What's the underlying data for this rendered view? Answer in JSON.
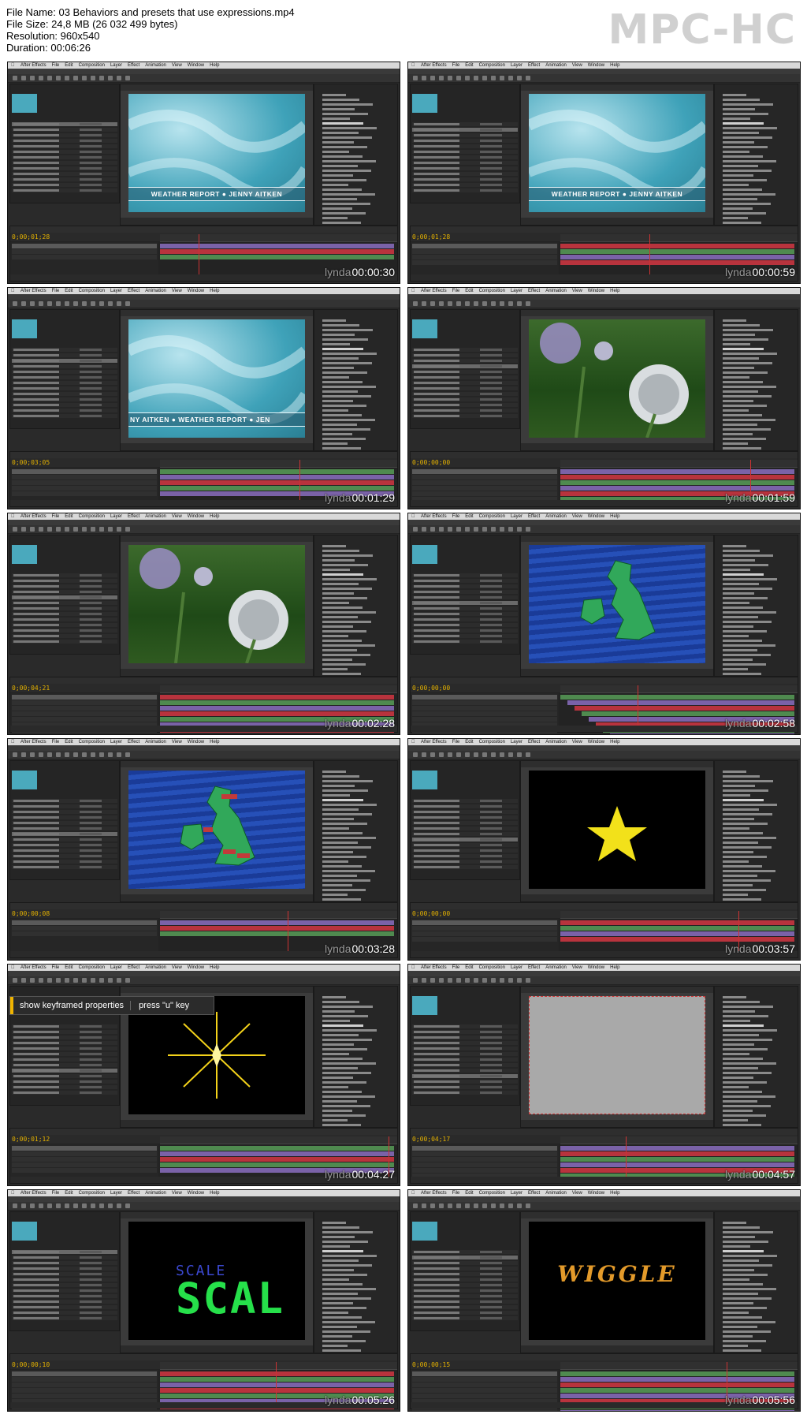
{
  "file_info": {
    "name": "File Name: 03 Behaviors and presets that use expressions.mp4",
    "size": "File Size: 24,8 MB (26 032 499 bytes)",
    "resolution": "Resolution: 960x540",
    "duration": "Duration: 00:06:26"
  },
  "brand": "MPC-HC",
  "watermark": "lynda",
  "app_menu": [
    "After Effects",
    "File",
    "Edit",
    "Composition",
    "Layer",
    "Effect",
    "Animation",
    "View",
    "Window",
    "Help"
  ],
  "lower_third": {
    "a": "WEATHER REPORT",
    "sep": "●",
    "b": "JENNY AITKEN",
    "shifted_a": "NY AITKEN",
    "shifted_b": "WEATHER REPORT",
    "shifted_c": "JEN"
  },
  "tooltip": {
    "left": "show keyframed properties",
    "right": "press \"u\" key"
  },
  "wiggle_text": "WIGGLE",
  "scale_text": "SCAL",
  "scale_ghost": "SCALE",
  "thumbs": [
    {
      "timestamp": "00:00:30",
      "timecode": "0;00;01;28",
      "scene": "lower"
    },
    {
      "timestamp": "00:00:59",
      "timecode": "0;00;01;28",
      "scene": "lower"
    },
    {
      "timestamp": "00:01:29",
      "timecode": "0;00;03;05",
      "scene": "lower-shift"
    },
    {
      "timestamp": "00:01:59",
      "timecode": "0;00;00;00",
      "scene": "flowers"
    },
    {
      "timestamp": "00:02:28",
      "timecode": "0;00;04;21",
      "scene": "flowers"
    },
    {
      "timestamp": "00:02:58",
      "timecode": "0;00;00;00",
      "scene": "map"
    },
    {
      "timestamp": "00:03:28",
      "timecode": "0;00;00;08",
      "scene": "map-labels"
    },
    {
      "timestamp": "00:03:57",
      "timecode": "0;00;00;00",
      "scene": "star"
    },
    {
      "timestamp": "00:04:27",
      "timecode": "0;00;01;12",
      "scene": "starburst"
    },
    {
      "timestamp": "00:04:57",
      "timecode": "0;00;04;17",
      "scene": "gray"
    },
    {
      "timestamp": "00:05:26",
      "timecode": "0;00;00;10",
      "scene": "scale"
    },
    {
      "timestamp": "00:05:56",
      "timecode": "0;00;00;15",
      "scene": "wiggle"
    }
  ],
  "colors": {
    "ae_dark": "#2a2a2a",
    "timecode": "#e6b300",
    "layer_red": "#b8333d",
    "layer_purple": "#7a62a8",
    "layer_green": "#4f8a4f"
  }
}
